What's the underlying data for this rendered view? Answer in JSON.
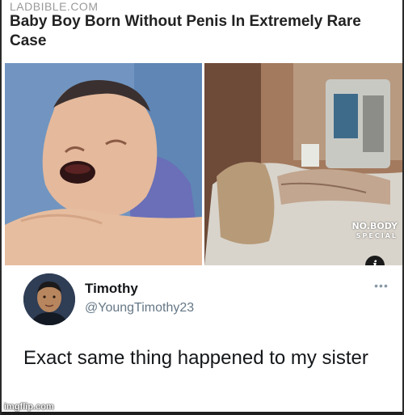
{
  "article": {
    "source": "LADBIBLE.COM",
    "headline": "Baby Boy Born Without Penis In Extremely Rare Case",
    "watermark_line1": "NO.BODY",
    "watermark_line2": "SPECIAL",
    "info_icon": "info-icon"
  },
  "tweet": {
    "display_name": "Timothy",
    "handle": "@YoungTimothy23",
    "text": "Exact same thing happened to my sister",
    "more_icon": "more-dots-icon"
  },
  "footer": {
    "watermark": "imgflip.com"
  },
  "colors": {
    "name": "#14171a",
    "handle": "#657786",
    "source": "#9a9a9a"
  }
}
